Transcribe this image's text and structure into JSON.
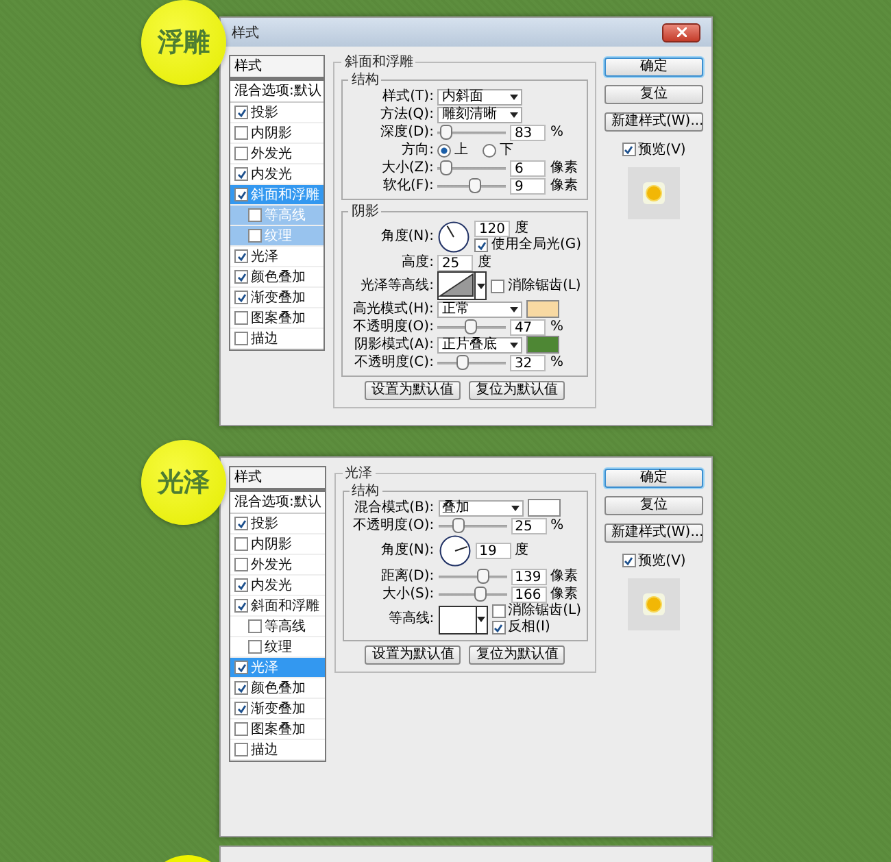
{
  "dialogs": [
    {
      "badge": "浮雕",
      "title": "样式",
      "styles_header": "样式",
      "blend_default": "混合选项:默认",
      "styles": [
        {
          "label": "投影",
          "checked": true,
          "selected": false
        },
        {
          "label": "内阴影",
          "checked": false,
          "selected": false
        },
        {
          "label": "外发光",
          "checked": false,
          "selected": false
        },
        {
          "label": "内发光",
          "checked": true,
          "selected": false
        },
        {
          "label": "斜面和浮雕",
          "checked": true,
          "selected": true,
          "children": [
            {
              "label": "等高线",
              "checked": false,
              "selected": false
            },
            {
              "label": "纹理",
              "checked": false,
              "selected": false
            }
          ]
        },
        {
          "label": "光泽",
          "checked": true,
          "selected": false
        },
        {
          "label": "颜色叠加",
          "checked": true,
          "selected": false
        },
        {
          "label": "渐变叠加",
          "checked": true,
          "selected": false
        },
        {
          "label": "图案叠加",
          "checked": false,
          "selected": false
        },
        {
          "label": "描边",
          "checked": false,
          "selected": false
        }
      ],
      "panel": {
        "title": "斜面和浮雕",
        "groups": [
          {
            "title": "结构",
            "rows": [
              {
                "kind": "dropdown",
                "label": "样式(T):",
                "value": "内斜面"
              },
              {
                "kind": "dropdown",
                "label": "方法(Q):",
                "value": "雕刻清晰"
              },
              {
                "kind": "slider",
                "label": "深度(D):",
                "level": 0.05,
                "value": "83",
                "unit": "%"
              },
              {
                "kind": "radio",
                "label": "方向:",
                "options": [
                  {
                    "label": "上",
                    "selected": true
                  },
                  {
                    "label": "下",
                    "selected": false
                  }
                ]
              },
              {
                "kind": "slider",
                "label": "大小(Z):",
                "level": 0.03,
                "value": "6",
                "unit": "像素"
              },
              {
                "kind": "slider",
                "label": "软化(F):",
                "level": 0.55,
                "value": "9",
                "unit": "像素"
              }
            ]
          },
          {
            "title": "阴影",
            "rows": [
              {
                "kind": "angle",
                "label": "角度(N):",
                "value": "120",
                "unit": "度",
                "check": {
                  "label": "使用全局光(G)",
                  "checked": true
                }
              },
              {
                "kind": "number",
                "label": "高度:",
                "value": "25",
                "unit": "度"
              },
              {
                "kind": "contour",
                "label": "光泽等高线:",
                "ramp": true,
                "checks": [
                  {
                    "label": "消除锯齿(L)",
                    "checked": false
                  }
                ]
              },
              {
                "kind": "dropdown",
                "label": "高光模式(H):",
                "value": "正常",
                "color": "#f8d9a2"
              },
              {
                "kind": "slider",
                "label": "不透明度(O):",
                "level": 0.47,
                "value": "47",
                "unit": "%"
              },
              {
                "kind": "dropdown",
                "label": "阴影模式(A):",
                "value": "正片叠底",
                "color": "#4e8734"
              },
              {
                "kind": "slider",
                "label": "不透明度(C):",
                "level": 0.32,
                "value": "32",
                "unit": "%"
              }
            ]
          }
        ],
        "footer": [
          "设置为默认值",
          "复位为默认值"
        ]
      },
      "buttons": [
        {
          "label": "确定",
          "default": true
        },
        {
          "label": "复位",
          "default": false
        },
        {
          "label": "新建样式(W)...",
          "default": false
        }
      ],
      "preview": {
        "label": "预览(V)",
        "checked": true
      }
    },
    {
      "badge": "光泽",
      "styles_header": "样式",
      "blend_default": "混合选项:默认",
      "styles": [
        {
          "label": "投影",
          "checked": true,
          "selected": false
        },
        {
          "label": "内阴影",
          "checked": false,
          "selected": false
        },
        {
          "label": "外发光",
          "checked": false,
          "selected": false
        },
        {
          "label": "内发光",
          "checked": true,
          "selected": false
        },
        {
          "label": "斜面和浮雕",
          "checked": true,
          "selected": false,
          "children": [
            {
              "label": "等高线",
              "checked": false,
              "selected": false
            },
            {
              "label": "纹理",
              "checked": false,
              "selected": false
            }
          ]
        },
        {
          "label": "光泽",
          "checked": true,
          "selected": true
        },
        {
          "label": "颜色叠加",
          "checked": true,
          "selected": false
        },
        {
          "label": "渐变叠加",
          "checked": true,
          "selected": false
        },
        {
          "label": "图案叠加",
          "checked": false,
          "selected": false
        },
        {
          "label": "描边",
          "checked": false,
          "selected": false
        }
      ],
      "panel": {
        "title": "光泽",
        "groups": [
          {
            "title": "结构",
            "rows": [
              {
                "kind": "dropdown",
                "label": "混合模式(B):",
                "value": "叠加",
                "color": "#ffffff"
              },
              {
                "kind": "slider",
                "label": "不透明度(O):",
                "level": 0.25,
                "value": "25",
                "unit": "%"
              },
              {
                "kind": "angle",
                "label": "角度(N):",
                "value": "19",
                "unit": "度"
              },
              {
                "kind": "slider",
                "label": "距离(D):",
                "level": 0.7,
                "value": "139",
                "unit": "像素"
              },
              {
                "kind": "slider",
                "label": "大小(S):",
                "level": 0.65,
                "value": "166",
                "unit": "像素"
              },
              {
                "kind": "contour",
                "label": "等高线:",
                "ramp": false,
                "checks": [
                  {
                    "label": "消除锯齿(L)",
                    "checked": false
                  },
                  {
                    "label": "反相(I)",
                    "checked": true
                  }
                ]
              }
            ]
          }
        ],
        "footer": [
          "设置为默认值",
          "复位为默认值"
        ]
      },
      "buttons": [
        {
          "label": "确定",
          "default": true
        },
        {
          "label": "复位",
          "default": false
        },
        {
          "label": "新建样式(W)...",
          "default": false
        }
      ],
      "preview": {
        "label": "预览(V)",
        "checked": true
      }
    }
  ]
}
